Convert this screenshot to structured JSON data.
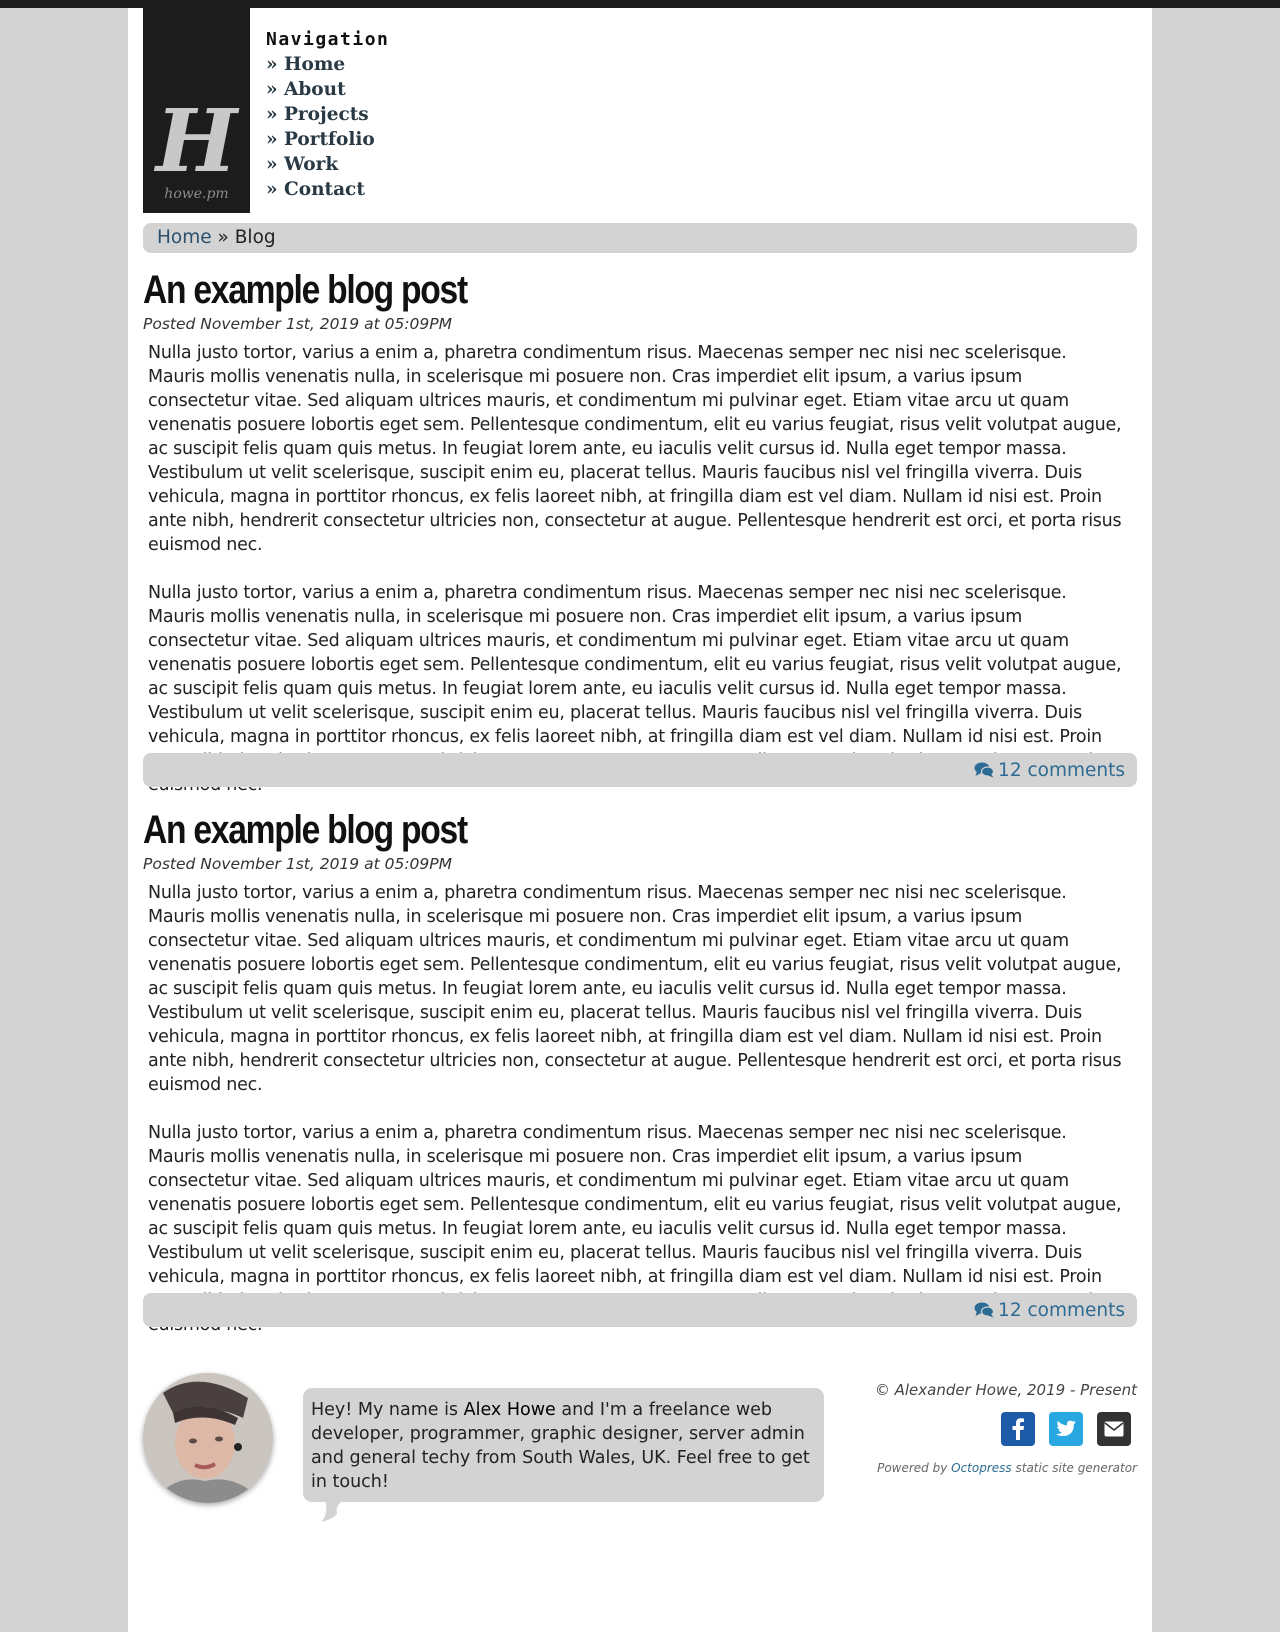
{
  "logo": {
    "mark": "H",
    "text": "howe.pm"
  },
  "nav": {
    "title": "Navigation",
    "items": [
      {
        "label": "» Home"
      },
      {
        "label": "» About"
      },
      {
        "label": "» Projects"
      },
      {
        "label": "» Portfolio"
      },
      {
        "label": "» Work"
      },
      {
        "label": "» Contact"
      }
    ]
  },
  "breadcrumb": {
    "home": "Home",
    "separator": " » ",
    "current": "Blog"
  },
  "posts": [
    {
      "title": "An example blog post",
      "meta": "Posted November 1st, 2019 at 05:09PM",
      "paragraphs": [
        "Nulla justo tortor, varius a enim a, pharetra condimentum risus. Maecenas semper nec nisi nec scelerisque. Mauris mollis venenatis nulla, in scelerisque mi posuere non. Cras imperdiet elit ipsum, a varius ipsum consectetur vitae. Sed aliquam ultrices mauris, et condimentum mi pulvinar eget. Etiam vitae arcu ut quam venenatis posuere lobortis eget sem. Pellentesque condimentum, elit eu varius feugiat, risus velit volutpat augue, ac suscipit felis quam quis metus. In feugiat lorem ante, eu iaculis velit cursus id. Nulla eget tempor massa. Vestibulum ut velit scelerisque, suscipit enim eu, placerat tellus. Mauris faucibus nisl vel fringilla viverra. Duis vehicula, magna in porttitor rhoncus, ex felis laoreet nibh, at fringilla diam est vel diam. Nullam id nisi est. Proin ante nibh, hendrerit consectetur ultricies non, consectetur at augue. Pellentesque hendrerit est orci, et porta risus euismod nec.",
        "Nulla justo tortor, varius a enim a, pharetra condimentum risus. Maecenas semper nec nisi nec scelerisque. Mauris mollis venenatis nulla, in scelerisque mi posuere non. Cras imperdiet elit ipsum, a varius ipsum consectetur vitae. Sed aliquam ultrices mauris, et condimentum mi pulvinar eget. Etiam vitae arcu ut quam venenatis posuere lobortis eget sem. Pellentesque condimentum, elit eu varius feugiat, risus velit volutpat augue, ac suscipit felis quam quis metus. In feugiat lorem ante, eu iaculis velit cursus id. Nulla eget tempor massa. Vestibulum ut velit scelerisque, suscipit enim eu, placerat tellus. Mauris faucibus nisl vel fringilla viverra. Duis vehicula, magna in porttitor rhoncus, ex felis laoreet nibh, at fringilla diam est vel diam. Nullam id nisi est. Proin ante nibh, hendrerit consectetur ultricies non, consectetur at augue. Pellentesque hendrerit est orci, et porta risus euismod nec."
      ],
      "comments": "12 comments"
    },
    {
      "title": "An example blog post",
      "meta": "Posted November 1st, 2019 at 05:09PM",
      "paragraphs": [
        "Nulla justo tortor, varius a enim a, pharetra condimentum risus. Maecenas semper nec nisi nec scelerisque. Mauris mollis venenatis nulla, in scelerisque mi posuere non. Cras imperdiet elit ipsum, a varius ipsum consectetur vitae. Sed aliquam ultrices mauris, et condimentum mi pulvinar eget. Etiam vitae arcu ut quam venenatis posuere lobortis eget sem. Pellentesque condimentum, elit eu varius feugiat, risus velit volutpat augue, ac suscipit felis quam quis metus. In feugiat lorem ante, eu iaculis velit cursus id. Nulla eget tempor massa. Vestibulum ut velit scelerisque, suscipit enim eu, placerat tellus. Mauris faucibus nisl vel fringilla viverra. Duis vehicula, magna in porttitor rhoncus, ex felis laoreet nibh, at fringilla diam est vel diam. Nullam id nisi est. Proin ante nibh, hendrerit consectetur ultricies non, consectetur at augue. Pellentesque hendrerit est orci, et porta risus euismod nec.",
        "Nulla justo tortor, varius a enim a, pharetra condimentum risus. Maecenas semper nec nisi nec scelerisque. Mauris mollis venenatis nulla, in scelerisque mi posuere non. Cras imperdiet elit ipsum, a varius ipsum consectetur vitae. Sed aliquam ultrices mauris, et condimentum mi pulvinar eget. Etiam vitae arcu ut quam venenatis posuere lobortis eget sem. Pellentesque condimentum, elit eu varius feugiat, risus velit volutpat augue, ac suscipit felis quam quis metus. In feugiat lorem ante, eu iaculis velit cursus id. Nulla eget tempor massa. Vestibulum ut velit scelerisque, suscipit enim eu, placerat tellus. Mauris faucibus nisl vel fringilla viverra. Duis vehicula, magna in porttitor rhoncus, ex felis laoreet nibh, at fringilla diam est vel diam. Nullam id nisi est. Proin ante nibh, hendrerit consectetur ultricies non, consectetur at augue. Pellentesque hendrerit est orci, et porta risus euismod nec."
      ],
      "comments": "12 comments"
    }
  ],
  "footer": {
    "bio_prefix": "Hey! My name is ",
    "bio_name": "Alex Howe",
    "bio_suffix": " and I'm a freelance web developer, programmer, graphic designer, server admin and general techy from South Wales, UK. Feel free to get in touch!",
    "copyright": "© Alexander Howe, 2019 - Present",
    "social": [
      {
        "icon": "facebook-icon",
        "color": "#1d5ba8"
      },
      {
        "icon": "twitter-icon",
        "color": "#29a7e1"
      },
      {
        "icon": "email-icon",
        "color": "#333333"
      }
    ],
    "powered_prefix": "Powered by ",
    "powered_link": "Octopress",
    "powered_suffix": " static site generator"
  },
  "colors": {
    "background": "#d3d3d3",
    "page": "#ffffff",
    "link": "#2c6b93",
    "logo_bg": "#1c1c1c"
  }
}
